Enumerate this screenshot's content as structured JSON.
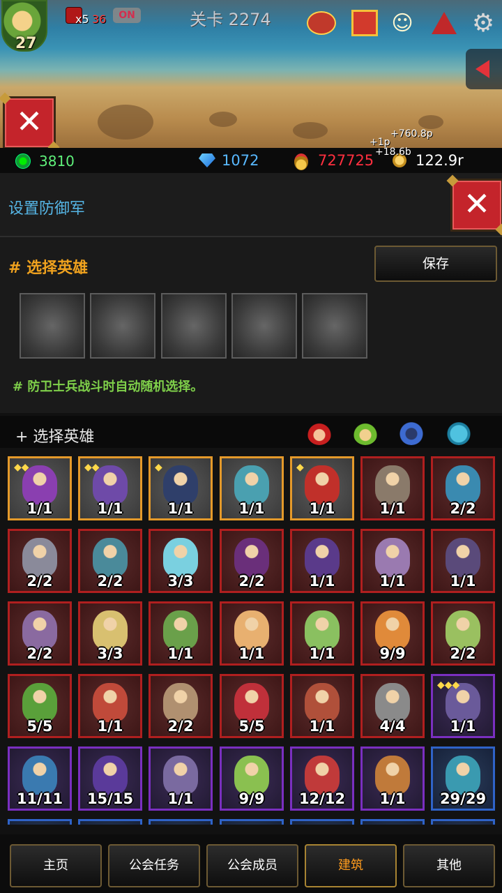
{
  "topbar": {
    "level": "27",
    "boost_mult": "x5",
    "boost_count": "36",
    "auto_toggle": "ON",
    "stage_title": "关卡 2274",
    "floating_gains": [
      "+760.8p",
      "+1p",
      "+18.6b"
    ]
  },
  "resources": {
    "guild_coin": "3810",
    "gems": "1072",
    "medals": "727725",
    "gold": "122.9r"
  },
  "defense": {
    "title": "设置防御军"
  },
  "selected": {
    "title": "# 选择英雄",
    "save_label": "保存",
    "slot_count": 5,
    "hint": "# 防卫士兵战斗时自动随机选择。"
  },
  "roster": {
    "title": "+ 选择英雄",
    "filters": [
      "red-element-icon",
      "green-element-icon",
      "blue-element-icon",
      "cyan-element-icon"
    ],
    "heroes": [
      {
        "count": "1/1",
        "rarity": "gold",
        "stars": 2,
        "color": "#8a3fb0"
      },
      {
        "count": "1/1",
        "rarity": "gold",
        "stars": 2,
        "color": "#6e4aa8"
      },
      {
        "count": "1/1",
        "rarity": "gold",
        "stars": 1,
        "color": "#2f3f6a"
      },
      {
        "count": "1/1",
        "rarity": "gold",
        "stars": 0,
        "color": "#4aa0b0"
      },
      {
        "count": "1/1",
        "rarity": "gold",
        "stars": 1,
        "color": "#c0302a"
      },
      {
        "count": "1/1",
        "rarity": "red",
        "stars": 0,
        "color": "#8a7a6a"
      },
      {
        "count": "2/2",
        "rarity": "red",
        "stars": 0,
        "color": "#3a8ab0"
      },
      {
        "count": "2/2",
        "rarity": "red",
        "stars": 0,
        "color": "#8a8a9a"
      },
      {
        "count": "2/2",
        "rarity": "red",
        "stars": 0,
        "color": "#4a8a9a"
      },
      {
        "count": "3/3",
        "rarity": "red",
        "stars": 0,
        "color": "#7ad0e0"
      },
      {
        "count": "2/2",
        "rarity": "red",
        "stars": 0,
        "color": "#6a2f7a"
      },
      {
        "count": "1/1",
        "rarity": "red",
        "stars": 0,
        "color": "#5a3a8a"
      },
      {
        "count": "1/1",
        "rarity": "red",
        "stars": 0,
        "color": "#9a7ab0"
      },
      {
        "count": "1/1",
        "rarity": "red",
        "stars": 0,
        "color": "#5a4a7a"
      },
      {
        "count": "2/2",
        "rarity": "red",
        "stars": 0,
        "color": "#8a6aa0"
      },
      {
        "count": "3/3",
        "rarity": "red",
        "stars": 0,
        "color": "#d8c070"
      },
      {
        "count": "1/1",
        "rarity": "red",
        "stars": 0,
        "color": "#6aa04a"
      },
      {
        "count": "1/1",
        "rarity": "red",
        "stars": 0,
        "color": "#e8b070"
      },
      {
        "count": "1/1",
        "rarity": "red",
        "stars": 0,
        "color": "#8ac060"
      },
      {
        "count": "9/9",
        "rarity": "red",
        "stars": 0,
        "color": "#e08a3a"
      },
      {
        "count": "2/2",
        "rarity": "red",
        "stars": 0,
        "color": "#9ac060"
      },
      {
        "count": "5/5",
        "rarity": "red",
        "stars": 0,
        "color": "#5aa03a"
      },
      {
        "count": "1/1",
        "rarity": "red",
        "stars": 0,
        "color": "#c04a3a"
      },
      {
        "count": "2/2",
        "rarity": "red",
        "stars": 0,
        "color": "#b09070"
      },
      {
        "count": "5/5",
        "rarity": "red",
        "stars": 0,
        "color": "#c0303a"
      },
      {
        "count": "1/1",
        "rarity": "red",
        "stars": 0,
        "color": "#b0503a"
      },
      {
        "count": "4/4",
        "rarity": "red",
        "stars": 0,
        "color": "#8a8a8a"
      },
      {
        "count": "1/1",
        "rarity": "purple",
        "stars": 3,
        "color": "#6a5a9a"
      },
      {
        "count": "11/11",
        "rarity": "purple",
        "stars": 0,
        "color": "#3a7ab0"
      },
      {
        "count": "15/15",
        "rarity": "purple",
        "stars": 0,
        "color": "#5a3a9a"
      },
      {
        "count": "1/1",
        "rarity": "purple",
        "stars": 0,
        "color": "#7a6aa0"
      },
      {
        "count": "9/9",
        "rarity": "purple",
        "stars": 0,
        "color": "#8ac050"
      },
      {
        "count": "12/12",
        "rarity": "purple",
        "stars": 0,
        "color": "#c03a3a"
      },
      {
        "count": "1/1",
        "rarity": "purple",
        "stars": 0,
        "color": "#c07a3a"
      },
      {
        "count": "29/29",
        "rarity": "blue",
        "stars": 0,
        "color": "#3a9ab0"
      },
      {
        "count": "",
        "rarity": "blue",
        "stars": 0,
        "color": "#2b3d5b"
      },
      {
        "count": "",
        "rarity": "blue",
        "stars": 0,
        "color": "#2b3d5b"
      },
      {
        "count": "",
        "rarity": "blue",
        "stars": 0,
        "color": "#2b3d5b"
      },
      {
        "count": "",
        "rarity": "blue",
        "stars": 0,
        "color": "#2b3d5b"
      },
      {
        "count": "",
        "rarity": "blue",
        "stars": 0,
        "color": "#2b3d5b"
      },
      {
        "count": "",
        "rarity": "blue",
        "stars": 0,
        "color": "#2b3d5b"
      },
      {
        "count": "",
        "rarity": "blue",
        "stars": 0,
        "color": "#2b3d5b"
      }
    ]
  },
  "nav": {
    "home": "主页",
    "guild_tasks": "公会任务",
    "guild_members": "公会成员",
    "buildings": "建筑",
    "others": "其他"
  },
  "colors": {
    "accent": "#f0a21e",
    "title_blue": "#56b6e6",
    "hint_green": "#7fd04a",
    "close_red": "#c4242b"
  }
}
